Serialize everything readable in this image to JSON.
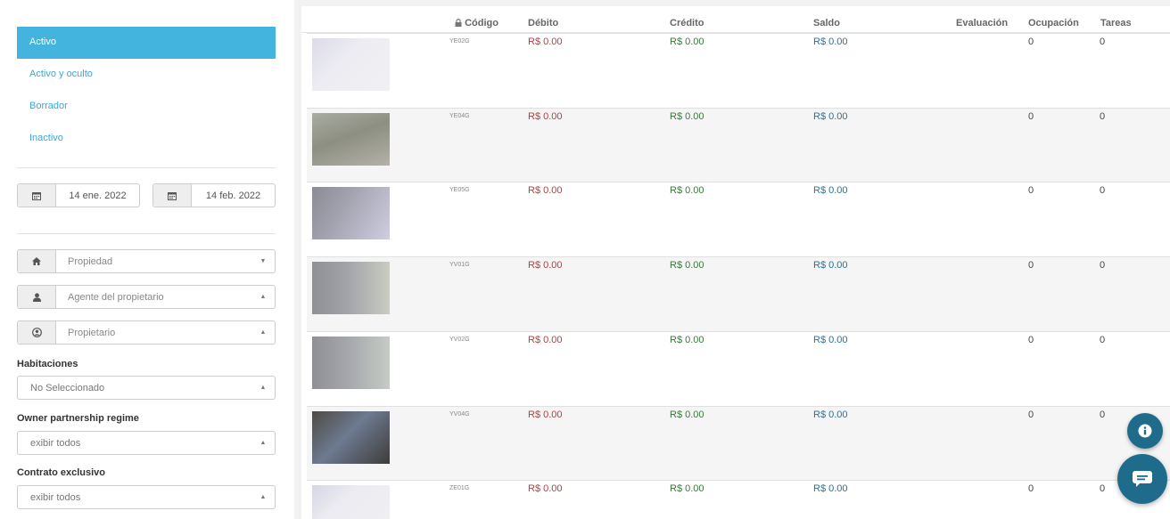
{
  "sidebar": {
    "status_items": [
      {
        "label": "Activo",
        "active": true
      },
      {
        "label": "Activo y oculto",
        "active": false
      },
      {
        "label": "Borrador",
        "active": false
      },
      {
        "label": "Inactivo",
        "active": false
      }
    ],
    "date_from": "14 ene. 2022",
    "date_to": "14 feb. 2022",
    "property_placeholder": "Propiedad",
    "agent_placeholder": "Agente del propietario",
    "owner_placeholder": "Propietario",
    "rooms_label": "Habitaciones",
    "rooms_value": "No Seleccionado",
    "partnership_label": "Owner partnership regime",
    "partnership_value": "exibir todos",
    "exclusive_label": "Contrato exclusivo",
    "exclusive_value": "exibir todos"
  },
  "table": {
    "headers": {
      "code": "Código",
      "debit": "Débito",
      "credit": "Crédito",
      "balance": "Saldo",
      "rating": "Evaluación",
      "occupancy": "Ocupación",
      "tasks": "Tareas"
    },
    "rows": [
      {
        "code": "YE02G",
        "debit": "R$ 0.00",
        "credit": "R$ 0.00",
        "balance": "R$ 0.00",
        "occupancy": "0",
        "tasks": "0"
      },
      {
        "code": "YE04G",
        "debit": "R$ 0.00",
        "credit": "R$ 0.00",
        "balance": "R$ 0.00",
        "occupancy": "0",
        "tasks": "0"
      },
      {
        "code": "YE05G",
        "debit": "R$ 0.00",
        "credit": "R$ 0.00",
        "balance": "R$ 0.00",
        "occupancy": "0",
        "tasks": "0"
      },
      {
        "code": "YV01G",
        "debit": "R$ 0.00",
        "credit": "R$ 0.00",
        "balance": "R$ 0.00",
        "occupancy": "0",
        "tasks": "0"
      },
      {
        "code": "YV02G",
        "debit": "R$ 0.00",
        "credit": "R$ 0.00",
        "balance": "R$ 0.00",
        "occupancy": "0",
        "tasks": "0"
      },
      {
        "code": "YV04G",
        "debit": "R$ 0.00",
        "credit": "R$ 0.00",
        "balance": "R$ 0.00",
        "occupancy": "0",
        "tasks": "0"
      },
      {
        "code": "ZE01G",
        "debit": "R$ 0.00",
        "credit": "R$ 0.00",
        "balance": "R$ 0.00",
        "occupancy": "0",
        "tasks": "0"
      }
    ]
  },
  "colors": {
    "accent": "#42b4de",
    "debit": "#a94442",
    "credit": "#3c763d",
    "balance": "#31708f",
    "fab": "#1f6b8c"
  },
  "icons": {
    "date": "calendar-icon",
    "property": "home-icon",
    "agent": "user-icon",
    "owner": "user-circle-icon",
    "code_header": "lock-icon",
    "info_fab": "info-icon",
    "chat_fab": "chat-icon"
  }
}
